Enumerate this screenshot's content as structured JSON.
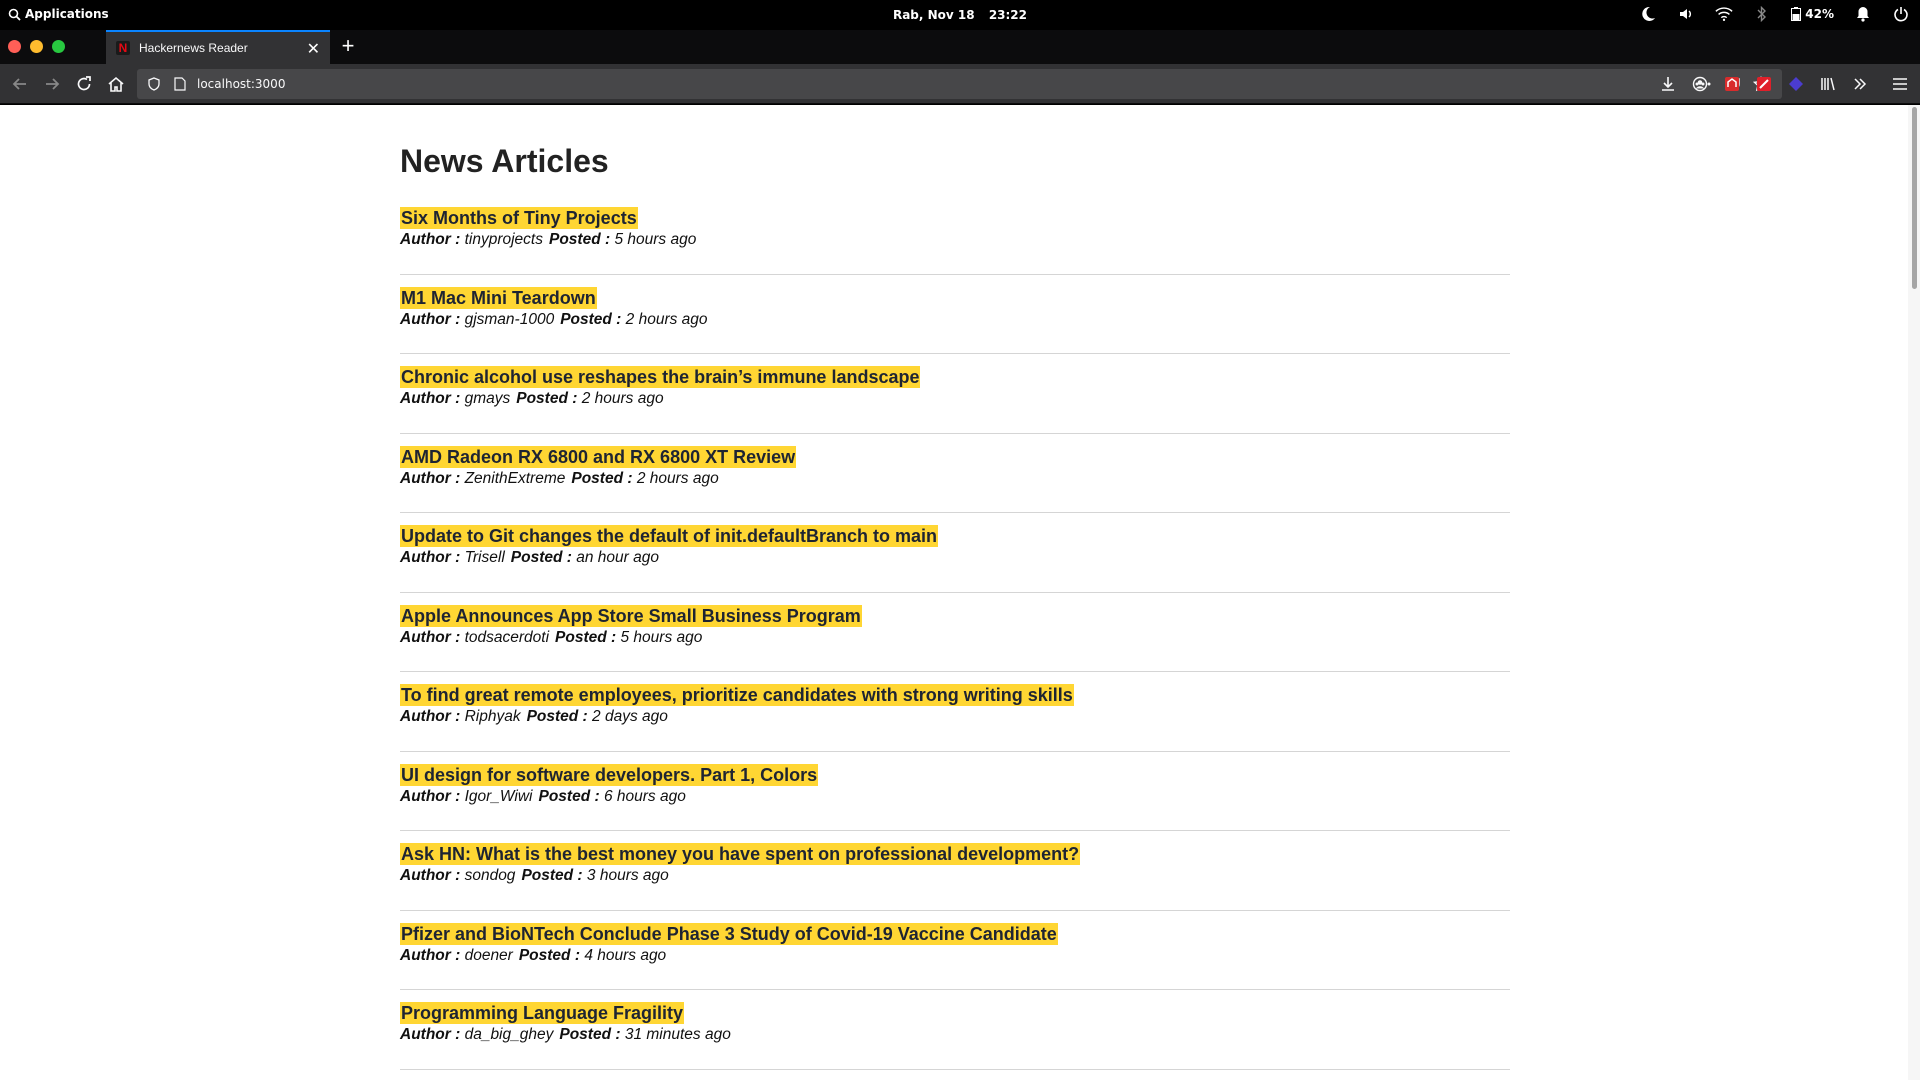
{
  "system_bar": {
    "apps_label": "Applications",
    "date": "Rab, Nov 18",
    "time": "23:22",
    "battery": "42%"
  },
  "browser": {
    "tab_title": "Hackernews Reader",
    "url": "localhost:3000",
    "colors": {
      "accent": "#0a84ff",
      "close": "#ff5f57",
      "minimize": "#febc2e",
      "maximize": "#28c840"
    }
  },
  "page": {
    "title": "News Articles",
    "author_label": "Author :",
    "posted_label": "Posted :",
    "highlight_color": "#ffd633",
    "articles": [
      {
        "title": "Six Months of Tiny Projects",
        "author": "tinyprojects",
        "posted": "5 hours ago"
      },
      {
        "title": "M1 Mac Mini Teardown",
        "author": "gjsman-1000",
        "posted": "2 hours ago"
      },
      {
        "title": "Chronic alcohol use reshapes the brain’s immune landscape",
        "author": "gmays",
        "posted": "2 hours ago"
      },
      {
        "title": "AMD Radeon RX 6800 and RX 6800 XT Review",
        "author": "ZenithExtreme",
        "posted": "2 hours ago"
      },
      {
        "title": "Update to Git changes the default of init.defaultBranch to main",
        "author": "Trisell",
        "posted": "an hour ago"
      },
      {
        "title": "Apple Announces App Store Small Business Program",
        "author": "todsacerdoti",
        "posted": "5 hours ago"
      },
      {
        "title": "To find great remote employees, prioritize candidates with strong writing skills",
        "author": "Riphyak",
        "posted": "2 days ago"
      },
      {
        "title": "UI design for software developers. Part 1, Colors",
        "author": "Igor_Wiwi",
        "posted": "6 hours ago"
      },
      {
        "title": "Ask HN: What is the best money you have spent on professional development?",
        "author": "sondog",
        "posted": "3 hours ago"
      },
      {
        "title": "Pfizer and BioNTech Conclude Phase 3 Study of Covid-19 Vaccine Candidate",
        "author": "doener",
        "posted": "4 hours ago"
      },
      {
        "title": "Programming Language Fragility",
        "author": "da_big_ghey",
        "posted": "31 minutes ago"
      }
    ]
  }
}
